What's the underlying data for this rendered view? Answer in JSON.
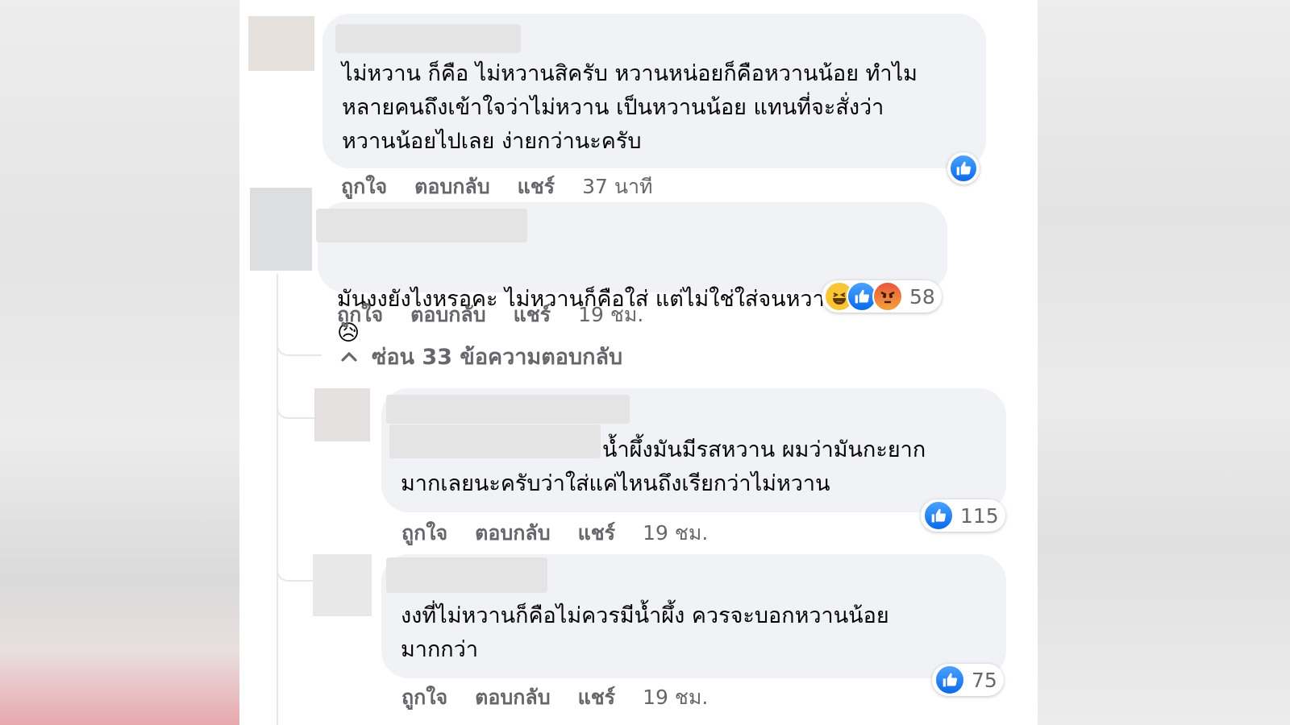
{
  "actions": {
    "like": "ถูกใจ",
    "reply": "ตอบกลับ",
    "share": "แชร์"
  },
  "comments": [
    {
      "text": "ไม่หวาน ก็คือ ไม่หวานสิครับ หวานหน่อยก็คือหวานน้อย ทำไม\nหลายคนถึงเข้าใจว่าไม่หวาน เป็นหวานน้อย แทนที่จะสั่งว่า\nหวานน้อยไปเลย ง่ายกว่านะครับ",
      "time": "37 นาที",
      "reactions": [
        "like-icon"
      ]
    },
    {
      "text": "มันงงยังไงหรอคะ ไม่หวานก็คือใส่ แต่ไม่ใช่ใส่จนหวาน",
      "emoji": "😥",
      "time": "19 ชม.",
      "reactions": [
        "haha-icon",
        "like-icon",
        "angry-icon"
      ],
      "reaction_count": "58"
    }
  ],
  "replies_toggle": {
    "icon": "⌃",
    "label": "ซ่อน 33 ข้อความตอบกลับ"
  },
  "replies": [
    {
      "text": "น้ำผึ้งมันมีรสหวาน ผมว่ามันกะยาก\nมากเลยนะครับว่าใส่แค่ไหนถึงเรียกว่าไม่หวาน",
      "time": "19 ชม.",
      "reaction_count": "115"
    },
    {
      "text": "งงที่ไม่หวานก็คือไม่ควรมีน้ำผึ้ง ควรจะบอกหวานน้อย\nมากกว่า",
      "time": "19 ชม.",
      "reaction_count": "75"
    }
  ],
  "colors": {
    "like_blue": "#0a6ae8",
    "bubble": "#f0f2f5",
    "meta_gray": "#65676b"
  }
}
